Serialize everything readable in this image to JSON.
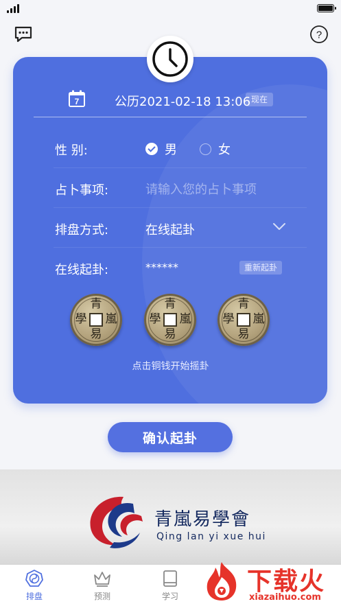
{
  "header": {
    "chat_icon": "chat-bubble-icon",
    "help_icon": "question-circle-icon"
  },
  "card": {
    "clock_icon": "clock-icon",
    "calendar_day": "7",
    "date_text": "公历2021-02-18 13:06",
    "now_label": "现在",
    "gender": {
      "label": "性    别:",
      "male": "男",
      "female": "女",
      "selected": "男"
    },
    "matter": {
      "label": "占卜事项:",
      "placeholder": "请输入您的占卜事项"
    },
    "method": {
      "label": "排盘方式:",
      "value": "在线起卦"
    },
    "online": {
      "label": "在线起卦:",
      "value": "******",
      "reset_label": "重新起卦"
    },
    "coins": [
      {
        "top": "青",
        "right": "嵐",
        "bottom": "易",
        "left": "學"
      },
      {
        "top": "青",
        "right": "嵐",
        "bottom": "易",
        "left": "學"
      },
      {
        "top": "青",
        "right": "嵐",
        "bottom": "易",
        "left": "學"
      }
    ],
    "hint": "点击铜钱开始摇卦"
  },
  "confirm_label": "确认起卦",
  "banner": {
    "cn": "青嵐易學會",
    "en": "Qing lan yi xue hui"
  },
  "tabs": [
    {
      "label": "排盘",
      "icon": "taiji-icon",
      "active": true
    },
    {
      "label": "预测",
      "icon": "crown-icon",
      "active": false
    },
    {
      "label": "学习",
      "icon": "book-icon",
      "active": false
    }
  ],
  "watermark": {
    "main": "下载火",
    "sub": "xiazaihuo.com"
  },
  "colors": {
    "primary": "#4f6fdf",
    "watermark": "#e6332a"
  }
}
